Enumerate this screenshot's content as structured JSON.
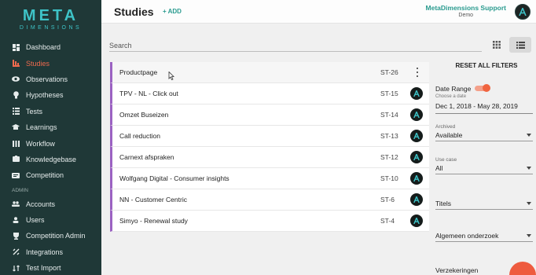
{
  "brand": {
    "name": "META",
    "sub": "DIMENSIONS"
  },
  "sidebar": {
    "items": [
      {
        "label": "Dashboard",
        "icon": "dashboard-icon"
      },
      {
        "label": "Studies",
        "icon": "studies-icon"
      },
      {
        "label": "Observations",
        "icon": "eye-icon"
      },
      {
        "label": "Hypotheses",
        "icon": "bulb-icon"
      },
      {
        "label": "Tests",
        "icon": "tests-icon"
      },
      {
        "label": "Learnings",
        "icon": "learnings-icon"
      },
      {
        "label": "Workflow",
        "icon": "workflow-icon"
      },
      {
        "label": "Knowledgebase",
        "icon": "knowledgebase-icon"
      },
      {
        "label": "Competition",
        "icon": "competition-icon"
      }
    ],
    "admin_label": "ADMIN",
    "admin_items": [
      {
        "label": "Accounts",
        "icon": "accounts-icon"
      },
      {
        "label": "Users",
        "icon": "users-icon"
      },
      {
        "label": "Competition Admin",
        "icon": "trophy-icon"
      },
      {
        "label": "Integrations",
        "icon": "integrations-icon"
      },
      {
        "label": "Test Import",
        "icon": "import-icon"
      }
    ]
  },
  "header": {
    "title": "Studies",
    "add_label": "+ ADD",
    "user_name": "MetaDimensions Support",
    "user_role": "Demo"
  },
  "search": {
    "placeholder": "Search"
  },
  "studies": [
    {
      "title": "Productpage",
      "id": "ST-26"
    },
    {
      "title": "TPV - NL - Click out",
      "id": "ST-15"
    },
    {
      "title": "Omzet Buseizen",
      "id": "ST-14"
    },
    {
      "title": "Call reduction",
      "id": "ST-13"
    },
    {
      "title": "Carnext afspraken",
      "id": "ST-12"
    },
    {
      "title": "Wolfgang Digital - Consumer insights",
      "id": "ST-10"
    },
    {
      "title": "NN - Customer Centric",
      "id": "ST-6"
    },
    {
      "title": "Simyo - Renewal study",
      "id": "ST-4"
    }
  ],
  "filters": {
    "reset_label": "RESET ALL FILTERS",
    "date_range": {
      "label": "Date Range",
      "hint": "Choose a date",
      "value": "Dec 1, 2018 - May 28, 2019",
      "enabled": true
    },
    "archived": {
      "label": "Archived",
      "value": "Available"
    },
    "use_case": {
      "label": "Use case",
      "value": "All"
    },
    "titels": {
      "value": "Titels"
    },
    "algemeen": {
      "value": "Algemeen onderzoek"
    },
    "verzekeringen": {
      "value": "Verzekeringen"
    }
  },
  "colors": {
    "sidebar_bg": "#1f3837",
    "brand": "#3ec3c7",
    "accent_orange": "#f06a4e",
    "accent_teal": "#2a9b8f",
    "row_accent": "#9b62c2"
  }
}
